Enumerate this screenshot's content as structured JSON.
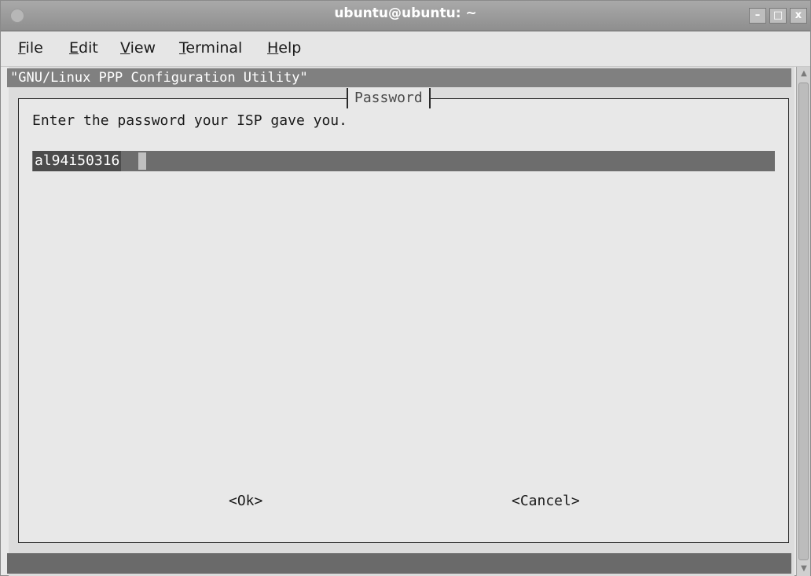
{
  "window": {
    "title": "ubuntu@ubuntu: ~",
    "controls": {
      "minimize": "–",
      "maximize": "□",
      "close": "x"
    }
  },
  "menubar": {
    "file": {
      "u": "F",
      "rest": "ile"
    },
    "edit": {
      "u": "E",
      "rest": "dit"
    },
    "view": {
      "u": "V",
      "rest": "iew"
    },
    "terminal": {
      "u": "T",
      "rest": "erminal"
    },
    "help": {
      "u": "H",
      "rest": "elp"
    }
  },
  "terminal": {
    "backtitle": "\"GNU/Linux PPP Configuration Utility\"",
    "dialog": {
      "title": "Password",
      "prompt": "Enter the password your ISP gave you.",
      "input_value": "al94i50316",
      "ok_label": "<Ok>",
      "cancel_label": "<Cancel>"
    }
  },
  "scrollbar": {
    "up_icon": "arrow-up-icon",
    "down_icon": "arrow-down-icon"
  }
}
